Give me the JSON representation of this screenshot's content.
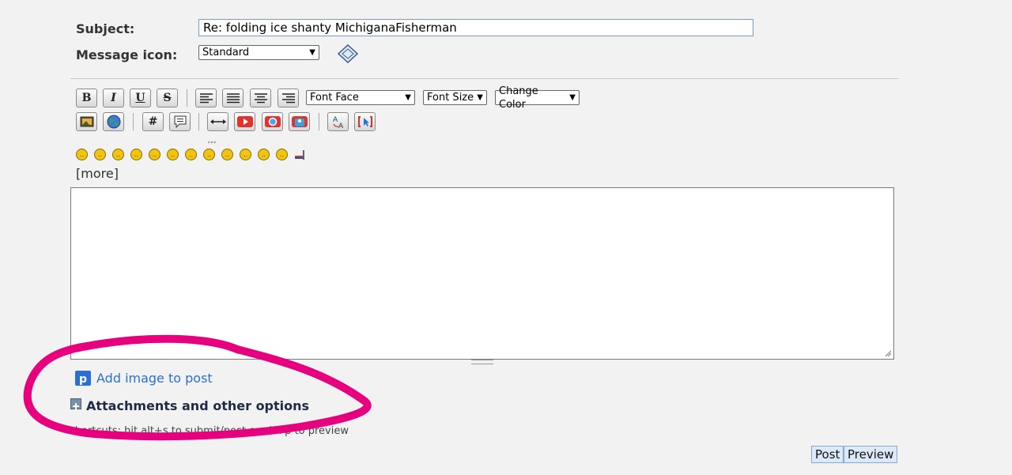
{
  "form": {
    "subject_label": "Subject:",
    "subject_value": "Re: folding ice shanty  MichiganaFisherman",
    "icon_label": "Message icon:",
    "icon_select": "Standard"
  },
  "toolbar": {
    "bold": "B",
    "italic": "I",
    "underline": "U",
    "strike": "S",
    "font_face": "Font Face",
    "font_size": "Font Size",
    "change_color": "Change Color",
    "hash": "#"
  },
  "smileys": {
    "more": "[more]"
  },
  "footer": {
    "add_image": "Add image to post",
    "attachments": "Attachments and other options",
    "shortcuts": "shortcuts: hit alt+s to submit/post or alt+p to preview",
    "post": "Post",
    "preview": "Preview"
  },
  "colors": {
    "annotation": "#e6007e",
    "link": "#2b6fd6"
  }
}
